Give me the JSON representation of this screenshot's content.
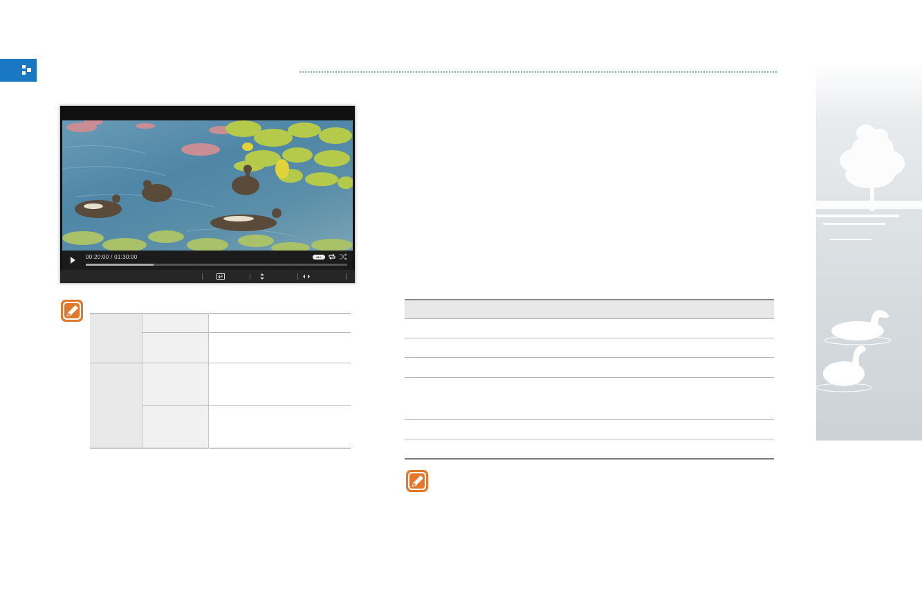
{
  "player": {
    "time_readout": "00:20:00 / 01:30:00",
    "progress": 0.26,
    "repeat_badge": "ALL"
  },
  "icons": {
    "section_marker": "navigation-arrows-icon",
    "note": "note-pencil-icon",
    "play": "play-icon",
    "repeat": "repeat-icon",
    "shuffle": "shuffle-icon",
    "enter": "enter-icon",
    "up_down": "up-down-arrows-icon",
    "left_right": "left-right-arrows-icon"
  },
  "colors": {
    "accent_blue": "#1a78c2",
    "note_orange": "#e2782a"
  }
}
